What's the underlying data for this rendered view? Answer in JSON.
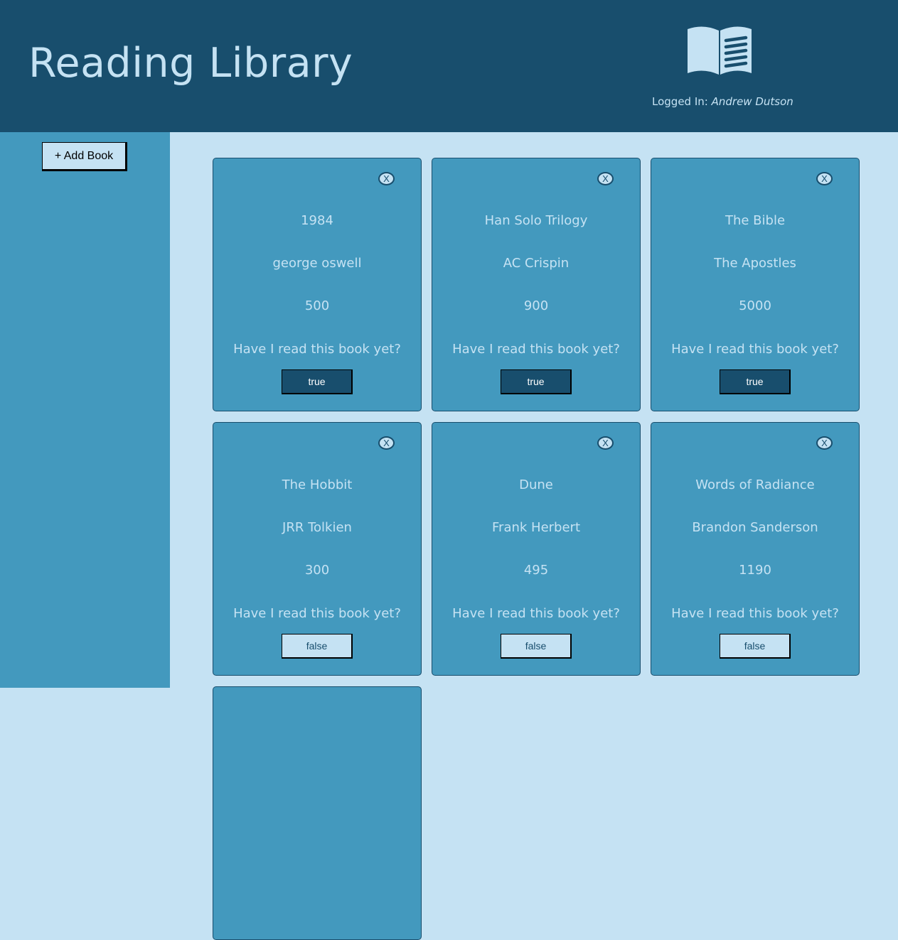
{
  "header": {
    "title": "Reading Library",
    "logo_icon": "open-book-icon",
    "logged_in_label": "Logged In:",
    "user_name": "Andrew Dutson"
  },
  "sidebar": {
    "add_book_label": "+ Add Book"
  },
  "colors": {
    "header_bg": "#184e6d",
    "sidebar_bg": "#4399be",
    "page_bg": "#c5e2f3",
    "card_bg": "#4399be",
    "text_light": "#c5e2f3"
  },
  "books": [
    {
      "remove_label": "X",
      "title": "1984",
      "author": "george oswell",
      "pages": "500",
      "question": "Have I read this book yet?",
      "read": "true"
    },
    {
      "remove_label": "X",
      "title": "Han Solo Trilogy",
      "author": "AC Crispin",
      "pages": "900",
      "question": "Have I read this book yet?",
      "read": "true"
    },
    {
      "remove_label": "X",
      "title": "The Bible",
      "author": "The Apostles",
      "pages": "5000",
      "question": "Have I read this book yet?",
      "read": "true"
    },
    {
      "remove_label": "X",
      "title": "The Hobbit",
      "author": "JRR Tolkien",
      "pages": "300",
      "question": "Have I read this book yet?",
      "read": "false"
    },
    {
      "remove_label": "X",
      "title": "Dune",
      "author": "Frank Herbert",
      "pages": "495",
      "question": "Have I read this book yet?",
      "read": "false"
    },
    {
      "remove_label": "X",
      "title": "Words of Radiance",
      "author": "Brandon Sanderson",
      "pages": "1190",
      "question": "Have I read this book yet?",
      "read": "false"
    }
  ]
}
